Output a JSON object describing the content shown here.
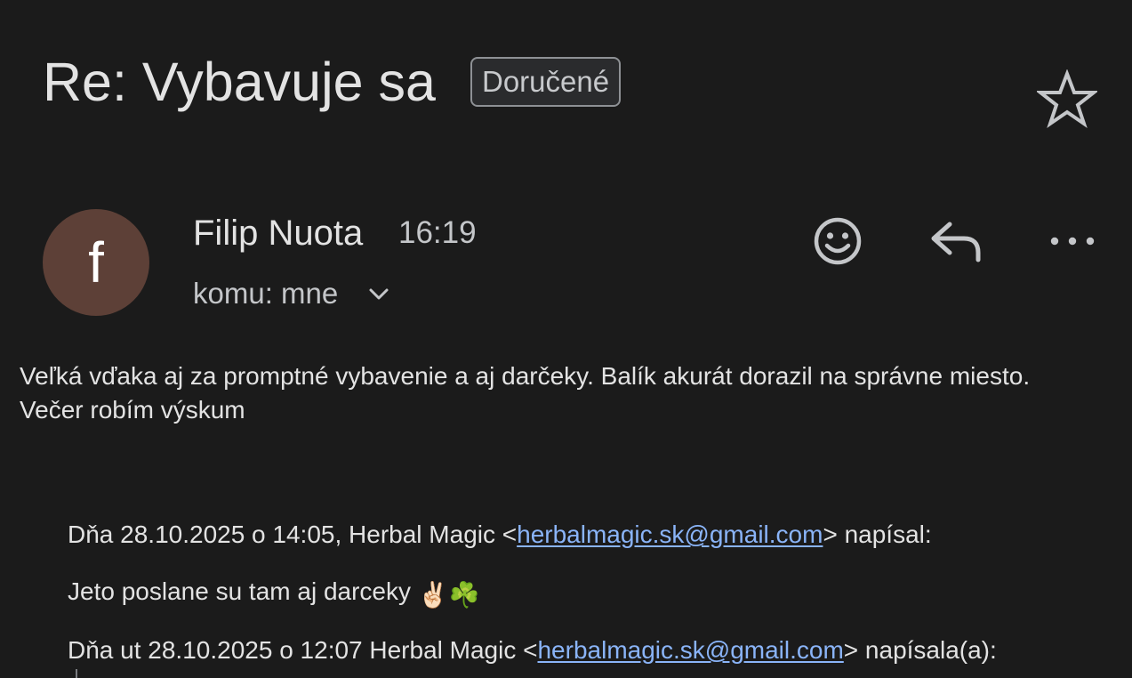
{
  "header": {
    "subject": "Re: Vybavuje sa",
    "label": "Doručené",
    "star_icon": "star-outline-icon"
  },
  "message": {
    "avatar_letter": "f",
    "avatar_color": "#5d4037",
    "sender_name": "Filip Nuota",
    "time": "16:19",
    "recipient": "komu: mne",
    "actions": {
      "emoji_icon": "smiley-icon",
      "reply_icon": "reply-icon",
      "more_icon": "more-dots-icon"
    },
    "body": {
      "line1": "Veľká vďaka aj za promptné vybavenie a aj darčeky. Balík akurát dorazil na správne miesto.",
      "line2": "Večer robím výskum"
    }
  },
  "quoted": {
    "attribution1_prefix": "Dňa 28.10.2025 o 14:05, Herbal Magic <",
    "attribution1_email": "herbalmagic.sk@gmail.com",
    "attribution1_suffix": "> napísal:",
    "reply_text": "Jeto poslane su tam aj darceky",
    "reply_emojis": "✌🏻☘️",
    "attribution2_prefix": "Dňa ut 28.10.2025 o 12:07 Herbal Magic <",
    "attribution2_email": "herbalmagic.sk@gmail.com",
    "attribution2_suffix": "> napísala(a):"
  },
  "colors": {
    "background": "#1b1b1b",
    "text": "#e3e3e3",
    "link": "#8ab4f8",
    "secondary_text": "#c4c6c9"
  }
}
